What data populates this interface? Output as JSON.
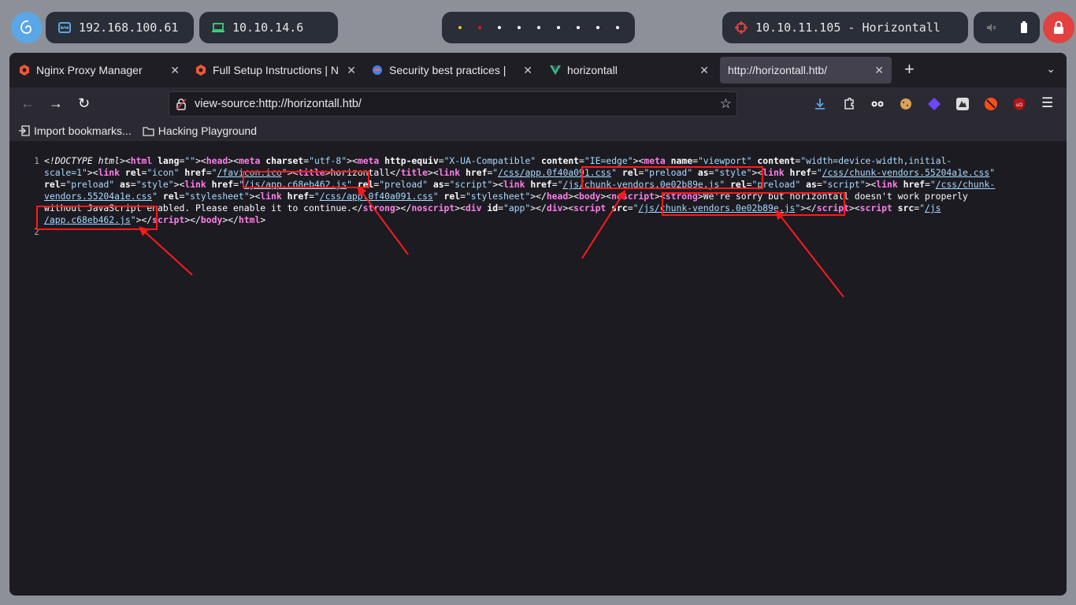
{
  "desktop": {
    "host_ip": "192.168.100.61",
    "vpn_ip": "10.10.14.6",
    "target": "10.10.11.105 - Horizontall",
    "dot_colors": [
      "#f5c211",
      "#e01b24",
      "#ffffff",
      "#ffffff",
      "#ffffff",
      "#ffffff",
      "#ffffff",
      "#ffffff",
      "#ffffff"
    ]
  },
  "tabs": [
    {
      "label": "Nginx Proxy Manager",
      "icon": "nginx-icon"
    },
    {
      "label": "Full Setup Instructions | N",
      "icon": "nginx-icon"
    },
    {
      "label": "Security best practices |",
      "icon": "security-icon"
    },
    {
      "label": "horizontall",
      "icon": "vue-icon"
    },
    {
      "label": "http://horizontall.htb/",
      "icon": "none",
      "active": true
    }
  ],
  "url": "view-source:http://horizontall.htb/",
  "bookmarks": [
    {
      "label": "Import bookmarks...",
      "icon": "import-icon"
    },
    {
      "label": "Hacking Playground",
      "icon": "folder-icon"
    }
  ],
  "source": {
    "line_numbers": [
      "1",
      "2"
    ],
    "doctype": "<!DOCTYPE",
    "html": "html",
    "lang_attr": "lang",
    "lang_val": "\"\"",
    "title_text": "horizontall",
    "charset_val": "\"utf-8\"",
    "http_equiv_val": "\"X-UA-Compatible\"",
    "content_ie": "\"IE=edge\"",
    "viewport_val": "\"viewport\"",
    "viewport_content_1": "\"width=device-width,initial-",
    "viewport_content_2": "scale=1\"",
    "icon_val": "\"icon\"",
    "favicon": "/favicon.ico",
    "css_app": "/css/app.0f40a091.css",
    "css_vendors": "/css/chunk-vendors.55204a1e.css",
    "css_vendors_1": "/css/chunk-",
    "css_vendors_2": "vendors.55204a1e.css",
    "js_app": "/js/app.c68eb462.js",
    "js_app_1": "/js",
    "js_app_2": "/app.c68eb462.js",
    "js_vendors": "/js/chunk-vendors.0e02b89e.js",
    "preload": "\"preload\"",
    "style": "\"style\"",
    "script": "\"script\"",
    "stylesheet": "\"stylesheet\"",
    "noscript_text": "We're sorry but horizontall doesn't work properly",
    "noscript_text_2": "without JavaScript enabled. Please enable it to continue.",
    "app_id": "\"app\""
  },
  "annotation_color": "#ff1a1a"
}
